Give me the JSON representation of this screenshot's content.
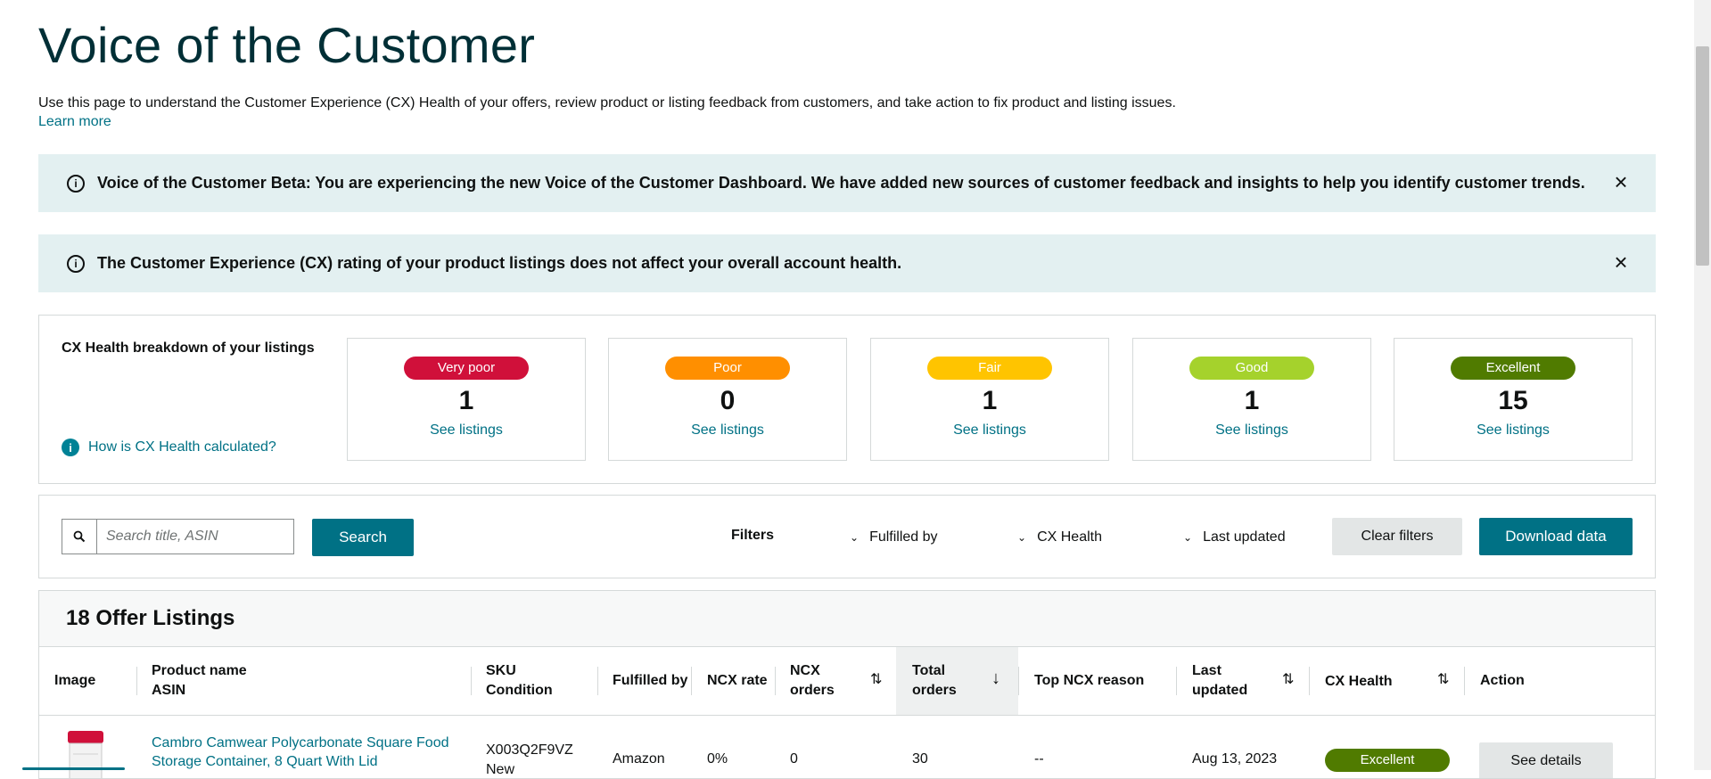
{
  "page": {
    "title": "Voice of the Customer",
    "description": "Use this page to understand the Customer Experience (CX) Health of your offers, review product or listing feedback from customers, and take action to fix product and listing issues.",
    "learn_more": "Learn more"
  },
  "banners": [
    {
      "text": "Voice of the Customer Beta: You are experiencing the new Voice of the Customer Dashboard. We have added new sources of customer feedback and insights to help you identify customer trends."
    },
    {
      "text": "The Customer Experience (CX) rating of your product listings does not affect your overall account health."
    }
  ],
  "cx_health": {
    "title": "CX Health breakdown of your listings",
    "how_link": "How is CX Health calculated?",
    "cards": [
      {
        "label": "Very poor",
        "count": "1",
        "link": "See listings",
        "color": "#d0103a"
      },
      {
        "label": "Poor",
        "count": "0",
        "link": "See listings",
        "color": "#ff8f00"
      },
      {
        "label": "Fair",
        "count": "1",
        "link": "See listings",
        "color": "#ffc400"
      },
      {
        "label": "Good",
        "count": "1",
        "link": "See listings",
        "color": "#a5d22c"
      },
      {
        "label": "Excellent",
        "count": "15",
        "link": "See listings",
        "color": "#507b00"
      }
    ]
  },
  "filters": {
    "search_placeholder": "Search title, ASIN",
    "search_button": "Search",
    "label": "Filters",
    "fulfilled_by": "Fulfilled by",
    "cx_health": "CX Health",
    "last_updated": "Last updated",
    "clear": "Clear filters",
    "download": "Download data"
  },
  "table": {
    "count_title": "18 Offer Listings",
    "headers": {
      "image": "Image",
      "product_name": "Product name",
      "asin": "ASIN",
      "sku": "SKU",
      "condition": "Condition",
      "fulfilled_by": "Fulfilled by",
      "ncx_rate": "NCX rate",
      "ncx_orders_1": "NCX",
      "ncx_orders_2": "orders",
      "total_orders_1": "Total",
      "total_orders_2": "orders",
      "top_ncx": "Top NCX reason",
      "last_updated_1": "Last",
      "last_updated_2": "updated",
      "cx_health": "CX Health",
      "action": "Action"
    },
    "rows": [
      {
        "product_line1": "Cambro Camwear Polycarbonate Square Food",
        "product_line2": "Storage Container, 8 Quart With Lid",
        "sku": "X003Q2F9VZ",
        "condition": "New",
        "fulfilled_by": "Amazon",
        "ncx_rate": "0%",
        "ncx_orders": "0",
        "total_orders": "30",
        "top_ncx": "--",
        "last_updated": "Aug 13, 2023",
        "cx_health": "Excellent",
        "action": "See details"
      }
    ]
  }
}
